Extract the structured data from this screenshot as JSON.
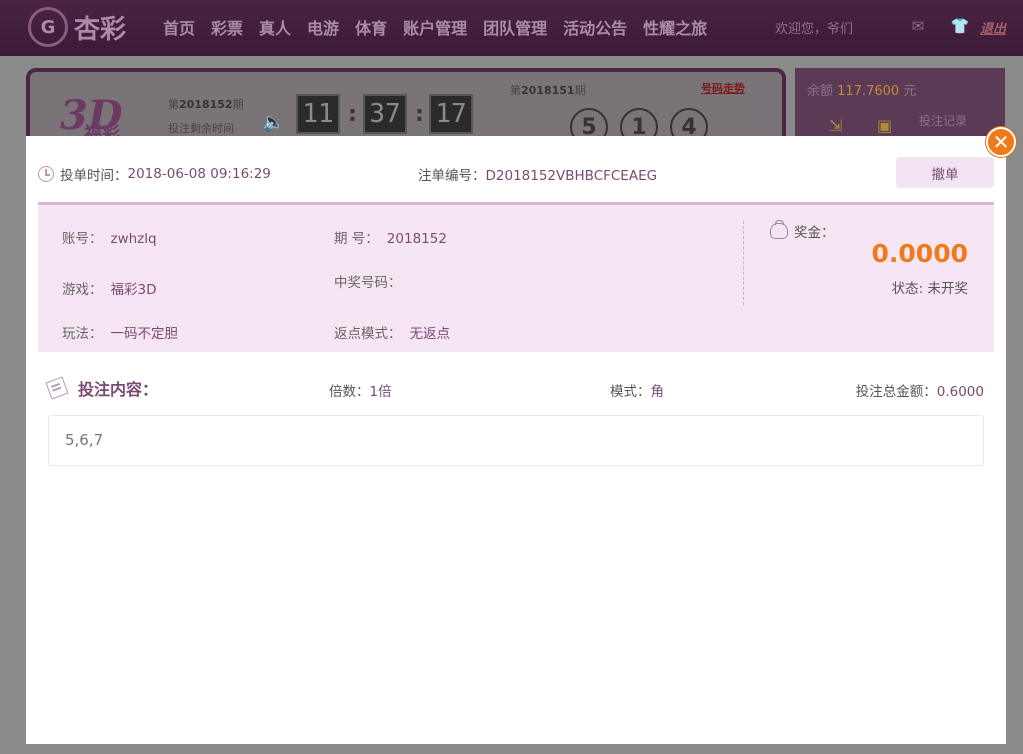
{
  "header": {
    "logo_mark": "G",
    "logo_text": "杏彩",
    "nav": [
      "首页",
      "彩票",
      "真人",
      "电游",
      "体育",
      "账户管理",
      "团队管理",
      "活动公告",
      "性耀之旅"
    ],
    "welcome": "欢迎您，爷们",
    "logout": "退出"
  },
  "background_panel": {
    "logo_main": "3D",
    "logo_sub": "福彩",
    "issue_prefix": "第",
    "issue": "2018152",
    "issue_suffix": "期",
    "remain_label": "投注剩余时间",
    "timer": [
      "11",
      "37",
      "17"
    ],
    "prev_prefix": "第",
    "prev_issue": "2018151",
    "prev_suffix": "期",
    "trend_label": "号码走势",
    "prev_balls": [
      "5",
      "1",
      "4"
    ],
    "balance_label": "余额",
    "balance_value": "117.7600",
    "balance_unit": "元",
    "bet_record": "投注记录"
  },
  "modal": {
    "close_glyph": "✕",
    "bet_time_label": "投单时间：",
    "bet_time": "2018-06-08 09:16:29",
    "order_label": "注单编号：",
    "order_no": "D2018152VBHBCFCEAEG",
    "cancel_button": "撤单",
    "info": {
      "account_label": "账号：",
      "account": "zwhzlq",
      "issue_label": "期 号：",
      "issue": "2018152",
      "game_label": "游戏：",
      "game": "福彩3D",
      "win_number_label": "中奖号码：",
      "win_number": "",
      "play_label": "玩法：",
      "play": "一码不定胆",
      "rebate_label": "返点模式：",
      "rebate": "无返点",
      "prize_label": "奖金：",
      "prize": "0.0000",
      "status": "状态: 未开奖"
    },
    "content": {
      "title": "投注内容：",
      "multiple_label": "倍数：",
      "multiple": "1倍",
      "mode_label": "模式：",
      "mode": "角",
      "total_label": "投注总金额：",
      "total": "0.6000",
      "numbers": "5,6,7"
    }
  }
}
